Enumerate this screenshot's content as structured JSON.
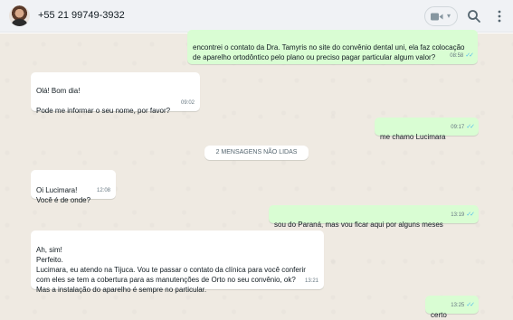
{
  "header": {
    "contact_name": "+55 21 99749-3932",
    "icons": [
      "avatar",
      "video-call-icon",
      "chevron-down-icon",
      "search-icon",
      "menu-icon"
    ]
  },
  "messages": [
    {
      "direction": "out",
      "text": "encontrei o contato da Dra. Tamyris no site do convênio dental uni, ela faz colocação de aparelho ortodôntico pelo plano ou preciso pagar particular algum valor?",
      "time": "08:58",
      "read": true
    },
    {
      "direction": "in",
      "text": "Olá! Bom dia!\n\nPode me informar o seu nome, por favor?",
      "time": "09:02"
    },
    {
      "direction": "out",
      "text": "me chamo Lucimara",
      "time": "09:17",
      "read": true
    },
    {
      "direction": "in",
      "text": "Oi Lucimara!\nVocê é de onde?",
      "time": "12:08"
    },
    {
      "direction": "out",
      "text": "sou do Paraná, mas vou ficar aqui por alguns meses",
      "time": "13:19",
      "read": true
    },
    {
      "direction": "in",
      "text": "Ah, sim!\nPerfeito.\nLucimara, eu atendo na Tijuca. Vou te passar o contato da clínica para você conferir com eles se tem a cobertura para as manutenções de Orto no seu convênio, ok?\nMas a instalação do aparelho é sempre no particular.",
      "time": "13:21"
    },
    {
      "direction": "out",
      "text": "certo",
      "time": "13:25",
      "read": true
    }
  ],
  "unread_divider": "2 MENSAGENS NÃO LIDAS",
  "colors": {
    "header_bg": "#f0f2f5",
    "chat_bg": "#efeae2",
    "incoming_bubble": "#ffffff",
    "outgoing_bubble": "#d9fdd3",
    "read_ticks": "#53bdeb"
  }
}
